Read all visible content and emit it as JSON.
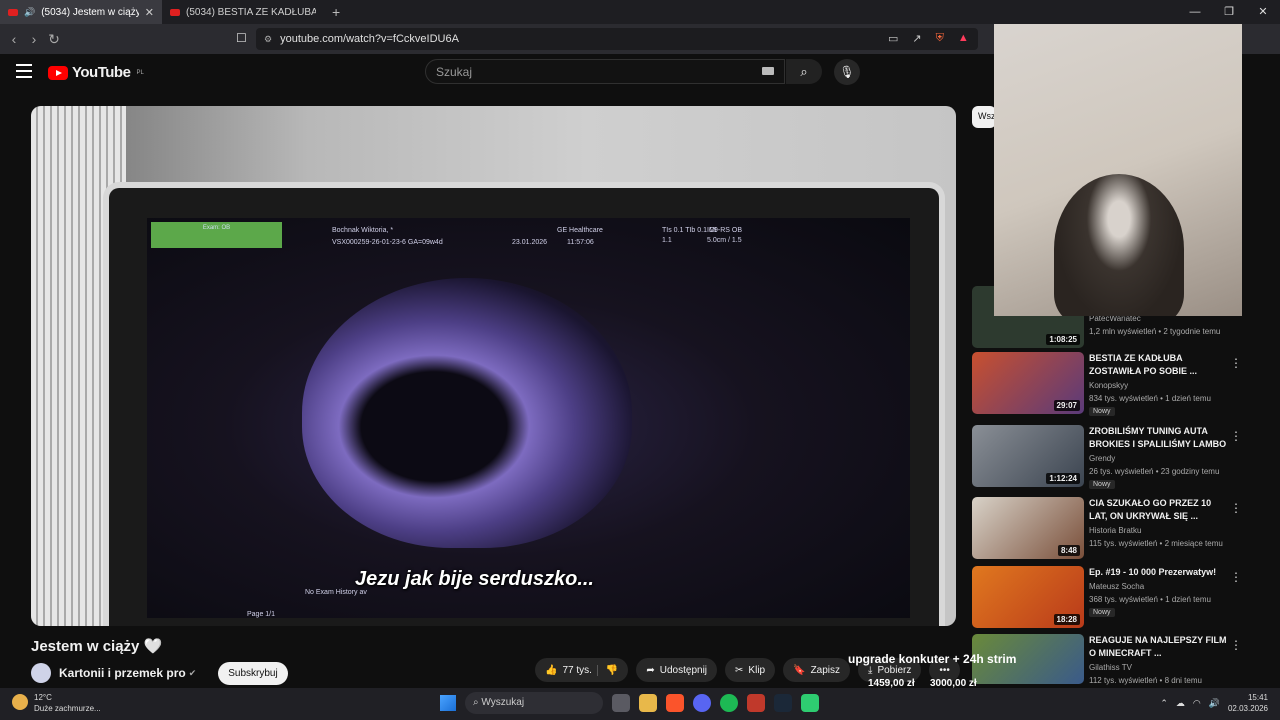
{
  "browser": {
    "tabs": [
      {
        "label": "(5034) Jestem w ciąży 🤍 - Yo",
        "active": true
      },
      {
        "label": "(5034) BESTIA ZE KADŁUBA ZOSTAW",
        "active": false
      }
    ],
    "new_tab": "+",
    "window_controls": [
      "—",
      "❐",
      "✕"
    ],
    "url": "youtube.com/watch?v=fCckveIDU6A"
  },
  "youtube": {
    "logo_text": "YouTube",
    "region": "PL",
    "search_placeholder": "Szukaj",
    "chip_label": "Wsz",
    "player": {
      "subtitle": "Jezu jak bije serduszko...",
      "screen": {
        "exam": "Exam: OB",
        "patient": "Bochnak Wiktoria, *",
        "patient_id": "VSX000259-26-01-23-6  GA=09w4d",
        "date": "23.01.2026",
        "time": "11:57:06",
        "maker": "GE Healthcare",
        "params": "TIs 0.1  TIb 0.1  MI 1.1",
        "probe": "IC9-RS OB 5.0cm / 1.5",
        "history": "No Exam History av",
        "page": "Page 1/1"
      }
    },
    "video": {
      "title": "Jestem w ciąży 🤍",
      "channel": "Kartonii i przemek pro",
      "subscribe": "Subskrybuj",
      "likes": "77 tys.",
      "share": "Udostępnij",
      "clip": "Klip",
      "save": "Zapisz",
      "download": "Pobierz",
      "more": "•••"
    },
    "recommendations": [
      {
        "title": "",
        "channel": "PatecWariatec",
        "meta": "1,2 mln wyświetleń • 2 tygodnie temu",
        "duration": "1:08:25",
        "new": false
      },
      {
        "title": "BESTIA ZE KADŁUBA ZOSTAWIŁA PO SOBIE ...",
        "channel": "Konopskyy",
        "meta": "834 tys. wyświetleń • 1 dzień temu",
        "duration": "29:07",
        "new": true
      },
      {
        "title": "ZROBILIŚMY TUNING AUTA BROKIES I SPALILIŚMY LAMBO",
        "channel": "Grendy",
        "meta": "26 tys. wyświetleń • 23 godziny temu",
        "duration": "1:12:24",
        "new": true
      },
      {
        "title": "CIA SZUKAŁO GO PRZEZ 10 LAT, ON UKRYWAŁ SIĘ ...",
        "channel": "Historia Bratku",
        "meta": "115 tys. wyświetleń • 2 miesiące temu",
        "duration": "8:48",
        "new": false
      },
      {
        "title": "Ep. #19 - 10 000 Prezerwatyw!",
        "channel": "Mateusz Socha",
        "meta": "368 tys. wyświetleń • 1 dzień temu",
        "duration": "18:28",
        "new": true
      },
      {
        "title": "REAGUJE NA NAJLEPSZY FILM O MINECRAFT ...",
        "channel": "Gilathiss TV",
        "meta": "112 tys. wyświetleń • 8 dni temu",
        "duration": "",
        "new": false
      }
    ]
  },
  "overlay": {
    "promo": "upgrade konkuter + 24h strim",
    "price_left": "1459,00 zł",
    "price_right": "3000,00 zł"
  },
  "taskbar": {
    "temp": "12°C",
    "weather": "Duże zachmurze...",
    "search": "Wyszukaj",
    "time": "15:41",
    "date": "02.03.2026"
  },
  "colors": {
    "yt_red": "#ff0000",
    "bg": "#0f0f0f",
    "accent_green": "#5ca84a"
  }
}
